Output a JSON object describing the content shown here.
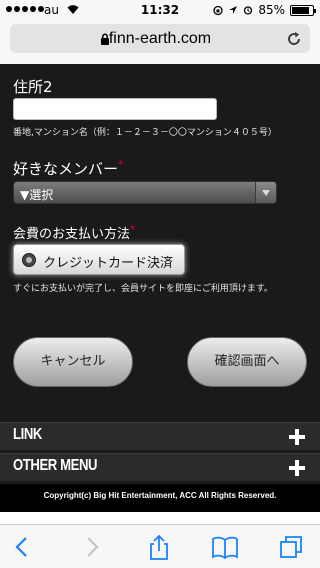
{
  "status_bar": {
    "carrier": "au",
    "time": "11:32",
    "battery_percent": "85%",
    "battery_level": 0.85
  },
  "browser": {
    "url": "finn-earth.com"
  },
  "form": {
    "address2_label": "住所2",
    "address2_value": "",
    "address2_hint": "番地,マンション名（例：１－２－３－〇〇マンション４０５号）",
    "member_label": "好きなメンバー",
    "member_required": "*",
    "member_select_value": "▼選択",
    "payment_label": "会費のお支払い方法",
    "payment_required": "*",
    "payment_option": "クレジットカード決済",
    "payment_hint": "すぐにお支払いが完了し、会員サイトを即座にご利用頂けます。",
    "cancel_label": "キャンセル",
    "confirm_label": "確認画面へ"
  },
  "footer": {
    "link_title": "LINK",
    "other_menu_title": "OTHER MENU",
    "copyright": "Copyright(c) Big Hit Entertainment, ACC All Rights Reserved."
  },
  "colors": {
    "content_bg": "#1a1a1a",
    "required_mark": "#e0002a",
    "ios_blue": "#1a82fb"
  }
}
